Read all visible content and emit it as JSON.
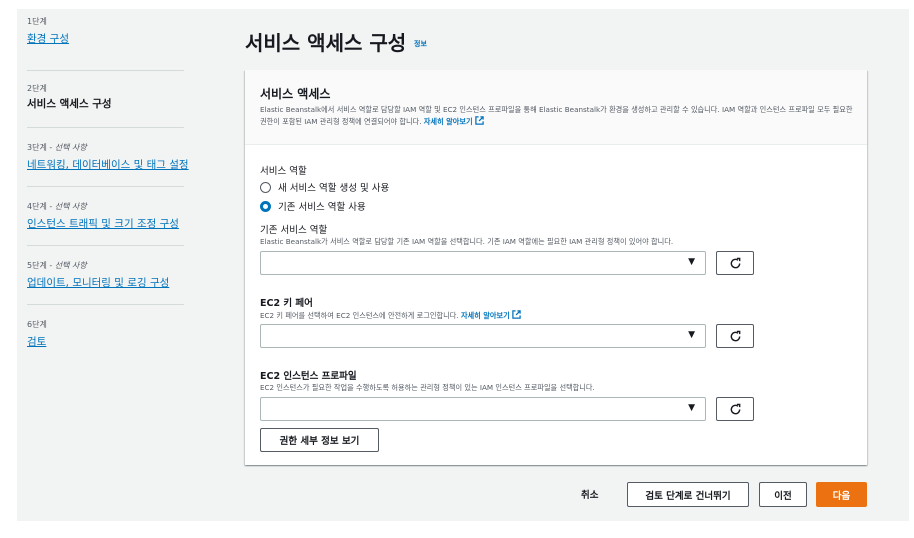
{
  "steps": [
    {
      "num": "1단계",
      "optional": "",
      "label": "환경 구성",
      "state": "link"
    },
    {
      "num": "2단계",
      "optional": "",
      "label": "서비스 액세스 구성",
      "state": "current"
    },
    {
      "num": "3단계 - ",
      "optional": "선택 사항",
      "label": "네트워킹, 데이터베이스 및 태그 설정",
      "state": "link"
    },
    {
      "num": "4단계 - ",
      "optional": "선택 사항",
      "label": "인스턴스 트래픽 및 크기 조정 구성",
      "state": "link"
    },
    {
      "num": "5단계 - ",
      "optional": "선택 사항",
      "label": "업데이트, 모니터링 및 로깅 구성",
      "state": "link"
    },
    {
      "num": "6단계",
      "optional": "",
      "label": "검토",
      "state": "link"
    }
  ],
  "page": {
    "title": "서비스 액세스 구성",
    "info": "정보"
  },
  "card": {
    "title": "서비스 액세스",
    "desc": "Elastic Beanstalk에서 서비스 역할로 담당할 IAM 역할 및 EC2 인스턴스 프로파일을 통해 Elastic Beanstalk가 환경을 생성하고 관리할 수 있습니다. IAM 역할과 인스턴스 프로파일 모두 필요한 권한이 포함된 IAM 관리형 정책에 연결되어야 합니다.",
    "learn_more": "자세히 알아보기"
  },
  "service_role": {
    "label": "서비스 역할",
    "options": [
      "새 서비스 역할 생성 및 사용",
      "기존 서비스 역할 사용"
    ],
    "selected_index": 1
  },
  "existing_role": {
    "label": "기존 서비스 역할",
    "desc": "Elastic Beanstalk가 서비스 역할로 담당할 기존 IAM 역할을 선택합니다. 기존 IAM 역할에는 필요한 IAM 관리형 정책이 있어야 합니다.",
    "value": ""
  },
  "key_pair": {
    "label": "EC2 키 페어",
    "desc": "EC2 키 페어를 선택하여 EC2 인스턴스에 안전하게 로그인합니다.",
    "learn_more": "자세히 알아보기",
    "value": ""
  },
  "instance_profile": {
    "label": "EC2 인스턴스 프로파일",
    "desc": "EC2 인스턴스가 필요한 작업을 수행하도록 허용하는 관리형 정책이 있는 IAM 인스턴스 프로파일을 선택합니다.",
    "value": "",
    "view_permissions": "권한 세부 정보 보기"
  },
  "footer": {
    "cancel": "취소",
    "skip": "검토 단계로 건너뛰기",
    "previous": "이전",
    "next": "다음"
  },
  "icons": {
    "caret": "caret-down-icon",
    "refresh": "refresh-icon",
    "external": "external-link-icon"
  },
  "colors": {
    "link": "#0073bb",
    "primary": "#ec7211",
    "background": "#f2f3f3"
  }
}
